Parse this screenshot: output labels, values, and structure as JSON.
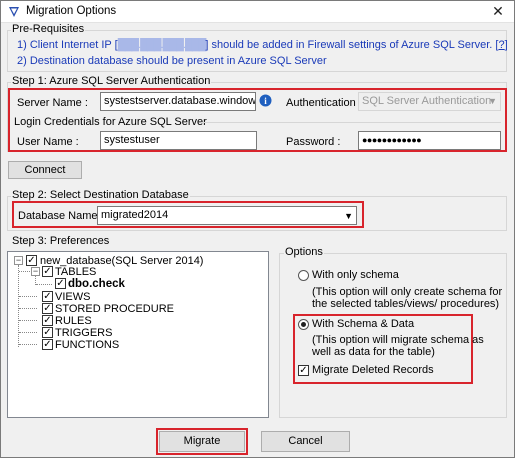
{
  "window": {
    "title": "Migration Options",
    "close_glyph": "✕"
  },
  "prerequisites": {
    "legend": "Pre-Requisites",
    "line1_prefix": "1) Client Internet IP [",
    "line1_redacted": "███.███.███.███",
    "line1_suffix": "] should be added in Firewall settings of Azure SQL Server. [",
    "help_link": "?",
    "line1_end": "]",
    "line2": "2) Destination database should be present in Azure SQL Server"
  },
  "step1": {
    "legend": "Step 1: Azure SQL Server Authentication",
    "server_name_label": "Server Name :",
    "server_name_value": "systestserver.database.windows.net",
    "info_icon": "i",
    "authentication_label": "Authentication :",
    "authentication_value": "SQL Server Authentication",
    "login_legend": "Login Credentials for Azure SQL Server",
    "user_name_label": "User Name :",
    "user_name_value": "systestuser",
    "password_label": "Password :",
    "password_value": "●●●●●●●●●●●●"
  },
  "connect_button": "Connect",
  "step2": {
    "legend": "Step 2: Select Destination Database",
    "database_label": "Database Name :",
    "database_value": "migrated2014"
  },
  "step3": {
    "legend": "Step 3: Preferences",
    "tree": {
      "root": "new_database(SQL Server 2014)",
      "tables": "TABLES",
      "table_item": "dbo.check",
      "views": "VIEWS",
      "stored_procedure": "STORED PROCEDURE",
      "rules": "RULES",
      "triggers": "TRIGGERS",
      "functions": "FUNCTIONS"
    }
  },
  "options": {
    "legend": "Options",
    "schema_only_label": "With only schema",
    "schema_only_desc1": "(This option will only create schema for",
    "schema_only_desc2": "the  selected tables/views/ procedures)",
    "schema_data_label": "With Schema & Data",
    "schema_data_desc1": "(This option will migrate schema as",
    "schema_data_desc2": "well as data for the table)",
    "migrate_deleted_label": "Migrate Deleted Records",
    "selected": "schema_data"
  },
  "buttons": {
    "migrate": "Migrate",
    "cancel": "Cancel"
  },
  "colors": {
    "highlight": "#d8242c",
    "link": "#1a3ab8"
  }
}
